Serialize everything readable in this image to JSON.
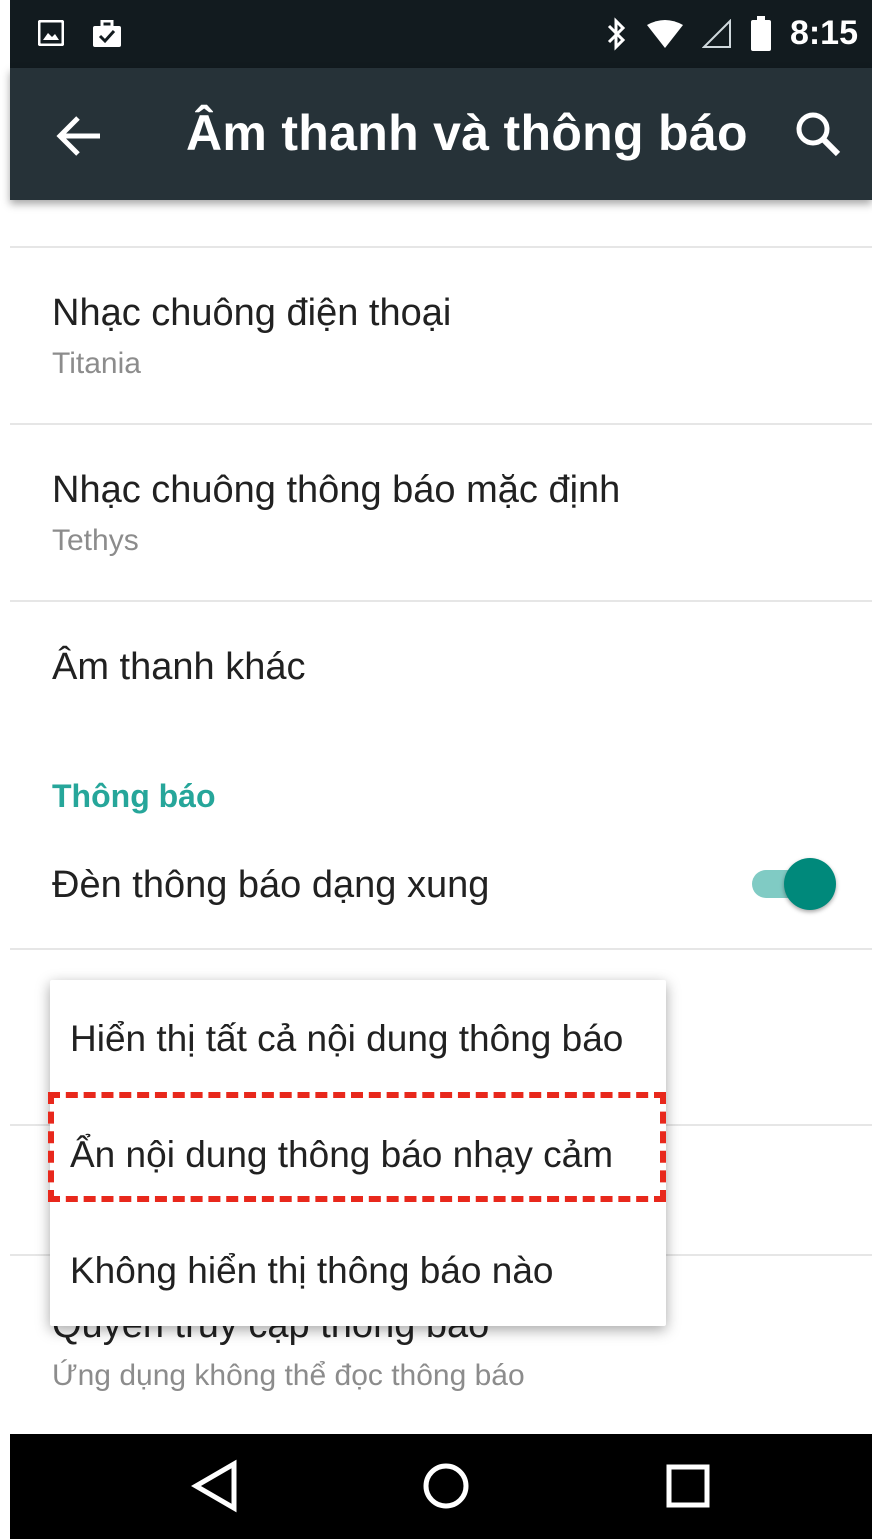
{
  "status_bar": {
    "time": "8:15",
    "left_icons": [
      "image-icon",
      "briefcase-check-icon"
    ],
    "right_icons": [
      "bluetooth-icon",
      "wifi-icon",
      "signal-icon",
      "battery-icon"
    ]
  },
  "app_bar": {
    "title": "Âm thanh và thông báo",
    "icons": [
      "back-arrow-icon",
      "search-icon"
    ]
  },
  "settings": {
    "phone_ringtone": {
      "title": "Nhạc chuông điện thoại",
      "value": "Titania"
    },
    "notification_ringtone": {
      "title": "Nhạc chuông thông báo mặc định",
      "value": "Tethys"
    },
    "other_sounds": {
      "title": "Âm thanh khác"
    },
    "notifications_header": "Thông báo",
    "pulse_light": {
      "title": "Đèn thông báo dạng xung",
      "enabled": true
    },
    "notification_access": {
      "title": "Quyền truy cập thông báo",
      "value": "Ứng dụng không thể đọc thông báo"
    }
  },
  "popup": {
    "options": [
      "Hiển thị tất cả nội dung thông báo",
      "Ẩn nội dung thông báo nhạy cảm",
      "Không hiển thị thông báo nào"
    ],
    "highlighted_option_index": 1
  },
  "nav_bar": {
    "icons": [
      "back-triangle-icon",
      "home-circle-icon",
      "recents-square-icon"
    ]
  },
  "colors": {
    "status_bar": "#121b1f",
    "app_bar": "#263238",
    "accent": "#26a69a",
    "toggle_thumb": "#00897b",
    "toggle_track": "#80cbc4",
    "highlight": "#e8281c"
  }
}
